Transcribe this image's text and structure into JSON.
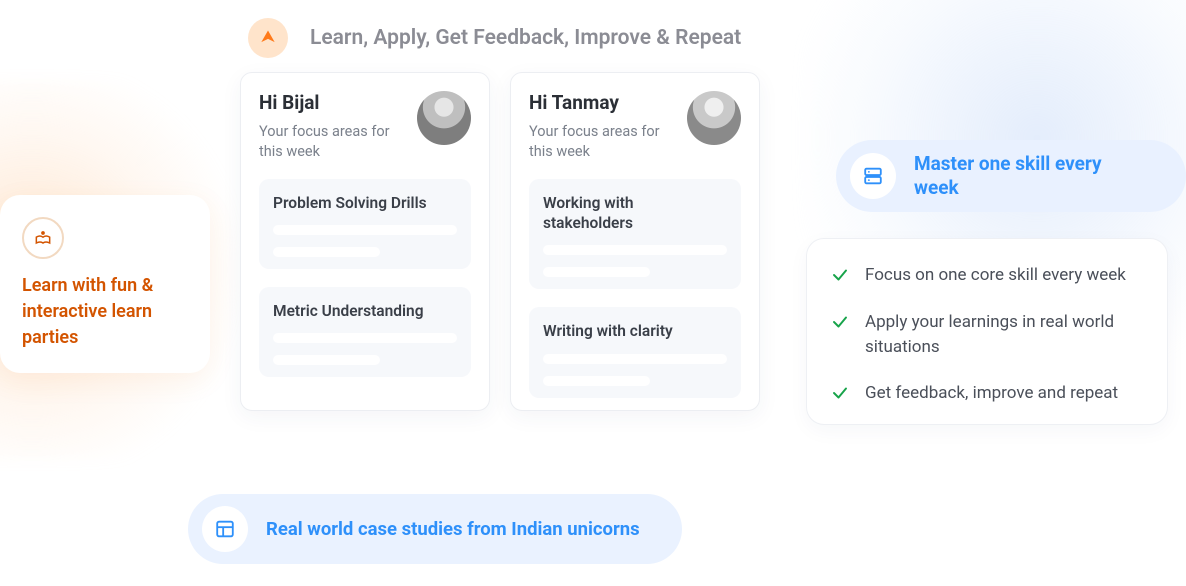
{
  "header": {
    "title": "Learn, Apply, Get Feedback, Improve & Repeat"
  },
  "orange_card": {
    "title": "Learn with fun & interactive learn parties"
  },
  "profiles": [
    {
      "greeting": "Hi Bijal",
      "subtitle": "Your focus areas for this week",
      "skills": [
        "Problem Solving Drills",
        "Metric Understanding"
      ]
    },
    {
      "greeting": "Hi Tanmay",
      "subtitle": "Your focus areas for this week",
      "skills": [
        "Working with stakeholders",
        "Writing with clarity"
      ]
    }
  ],
  "blue_pill": {
    "text": "Real world case studies from Indian unicorns"
  },
  "master_pill": {
    "text": "Master one skill every week"
  },
  "panel": {
    "bullets": [
      "Focus on one core skill every week",
      "Apply your learnings in real world situations",
      "Get feedback, improve and repeat"
    ]
  }
}
